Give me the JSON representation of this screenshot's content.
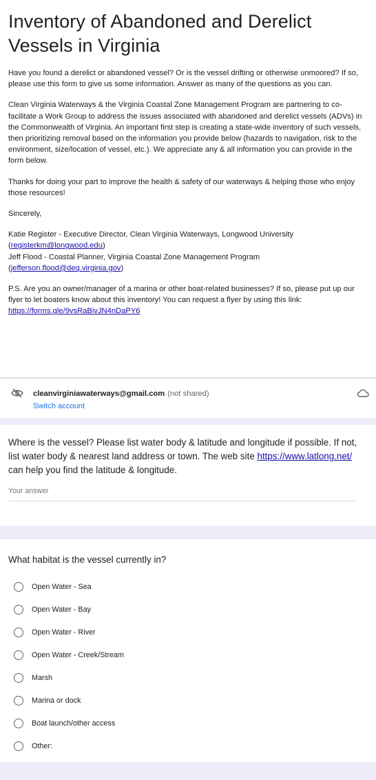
{
  "form": {
    "title": "Inventory of Abandoned and Derelict Vessels in Virginia",
    "intro": "Have you found a derelict or abandoned vessel? Or is the vessel drifting or otherwise unmoored? If so, please use this form to give us some information. Answer as many of the questions as you can.",
    "partnership": "Clean Virginia Waterways & the Virginia Coastal Zone Management Program are partnering to co-facilitate a Work Group to address the issues associated with abandoned and derelict vessels (ADVs) in the Commonwealth of Virginia. An important first step is creating a state-wide inventory of such vessels, then prioritizing removal based on the information you provide below (hazards to navigation, risk to the environment, size/location of vessel, etc.). We appreciate any & all information you can provide in the form below.",
    "thanks": "Thanks for doing your part to improve the health & safety of our waterways & helping those who enjoy those resources!",
    "closing": "Sincerely,",
    "sig1_text": "Katie Register - Executive Director, Clean Virginia Waterways, Longwood University",
    "sig1_email": "registerkm@longwood.edu",
    "sig2_text": "Jeff Flood - Coastal Planner, Virginia Coastal Zone Management Program",
    "sig2_email": "jefferson.flood@deq.virginia.gov",
    "ps_text": "P.S. Are you an owner/manager of a marina or other boat-related businesses? If so, please put up our flyer to let boaters know about this inventory! You can request a flyer by using this link:",
    "ps_link": "https://forms.gle/9vsRaBivJN4nDaPY6"
  },
  "account": {
    "email": "cleanvirginiawaterways@gmail.com",
    "not_shared": "(not shared)",
    "switch": "Switch account"
  },
  "q1": {
    "text_a": "Where is the vessel? Please list water body & latitude and longitude if possible. If not, list water body & nearest land address or town. The web site",
    "link": "https://www.latlong.net/",
    "text_b": "can help you find the latitude & longitude.",
    "placeholder": "Your answer"
  },
  "q2": {
    "title": "What habitat is the vessel currently in?",
    "options": [
      "Open Water - Sea",
      "Open Water - Bay",
      "Open Water - River",
      "Open Water - Creek/Stream",
      "Marsh",
      "Marina or dock",
      "Boat launch/other access",
      "Other:"
    ]
  },
  "colors": {
    "link": "#1a0dab",
    "switch": "#1a73e8",
    "background": "#f0ebf8"
  }
}
